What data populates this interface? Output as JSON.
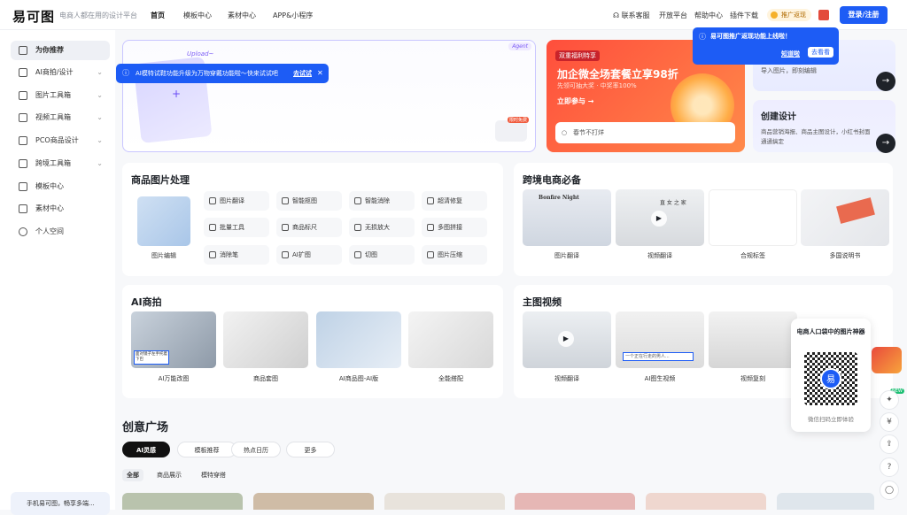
{
  "brand": {
    "logo": "易可图",
    "slogan": "电商人都在用的设计平台"
  },
  "topnav": [
    "首页",
    "模板中心",
    "素材中心",
    "APP&小程序"
  ],
  "toolbar": {
    "service": "联系客服",
    "open": "开放平台",
    "help": "帮助中心",
    "plugin": "插件下载",
    "promo": "推广返现",
    "login": "登录/注册"
  },
  "sidebar": {
    "items": [
      {
        "label": "为你推荐"
      },
      {
        "label": "AI商拍/设计"
      },
      {
        "label": "图片工具箱"
      },
      {
        "label": "视频工具箱"
      },
      {
        "label": "PCO商品设计"
      },
      {
        "label": "跨境工具箱"
      },
      {
        "label": "模板中心"
      },
      {
        "label": "素材中心"
      },
      {
        "label": "个人空间"
      }
    ],
    "bottom": "手机易可图，畅享多端..."
  },
  "hero": {
    "agent": "Agent",
    "upload": "Upload~",
    "tip": "AI模特试鞋功能升级为万物穿戴功能啦～快来试试吧",
    "tip_link": "去试试",
    "badge": "限时免费"
  },
  "banner": {
    "tag": "双重福利特享",
    "title": "加企微全场套餐立享98折",
    "sub": "先领可抽大奖 · 中奖率100%",
    "cta": "立即参与",
    "search": "春节不打烊"
  },
  "notice": {
    "text": "易可图推广返现功能上线啦！",
    "ok": "知道啦",
    "go": "去看看"
  },
  "side_cards": {
    "card1_desc": "导入图片，即刻编辑",
    "card2_title": "创建设计",
    "card2_desc": "商品营销海报、商品主图设计，小红书封面通通搞定"
  },
  "product_tools": {
    "title": "商品图片处理",
    "feature": "图片编辑",
    "tools": [
      "图片翻译",
      "智能抠图",
      "智能消除",
      "超清修复",
      "批量工具",
      "商品标尺",
      "无损放大",
      "多图拼接",
      "消除笔",
      "AI扩图",
      "切图",
      "图片压缩"
    ]
  },
  "crossborder": {
    "title": "跨境电商必备",
    "items": [
      "图片翻译",
      "视频翻译",
      "合规标签",
      "多国说明书"
    ],
    "thumb1_text": "Bonfire Night",
    "thumb2_text": "直 女 之 家"
  },
  "ai_shoot": {
    "title": "AI商拍",
    "items": [
      "AI万能改图",
      "商品套图",
      "AI商品图-AI版",
      "全能搭配"
    ],
    "thumb1_text": "面对镜子左手托着下巴"
  },
  "main_video": {
    "title": "主图视频",
    "items": [
      "视频翻译",
      "AI图生视频",
      "视频复刻"
    ],
    "thumb2_text": "一个正在行走的男人..."
  },
  "qr": {
    "title": "电商人口袋中的图片神器",
    "caption": "微信扫码立即体验",
    "logo": "易"
  },
  "creative": {
    "title": "创意广场",
    "chips": [
      "AI灵感",
      "模板推荐",
      "热点日历",
      "更多"
    ],
    "subs": [
      "全部",
      "商品展示",
      "模特穿搭"
    ]
  },
  "right_tools": {
    "new": "NEW"
  }
}
